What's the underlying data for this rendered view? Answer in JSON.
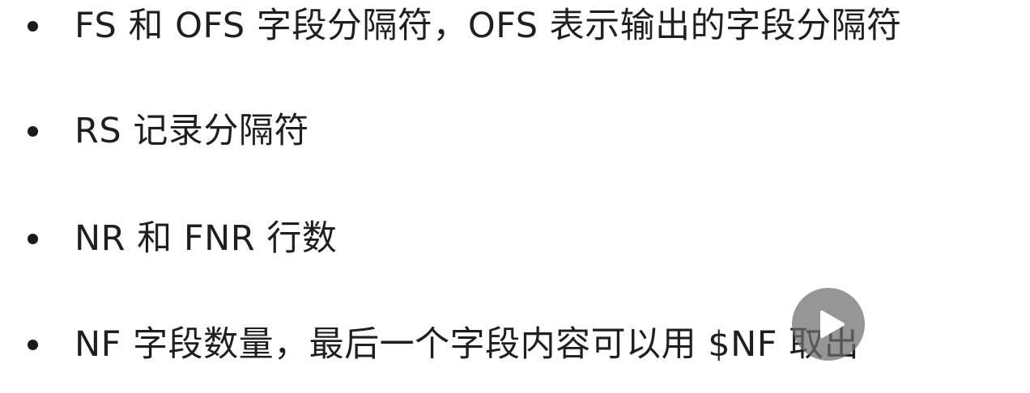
{
  "bullets": [
    {
      "text": "FS 和 OFS 字段分隔符，OFS 表示输出的字段分隔符"
    },
    {
      "text": "RS 记录分隔符"
    },
    {
      "text": "NR 和 FNR 行数"
    },
    {
      "text": "NF 字段数量，最后一个字段内容可以用 $NF 取出"
    }
  ],
  "player": {
    "play_icon": "play-icon",
    "overlay_color": "#6e6e6e"
  }
}
